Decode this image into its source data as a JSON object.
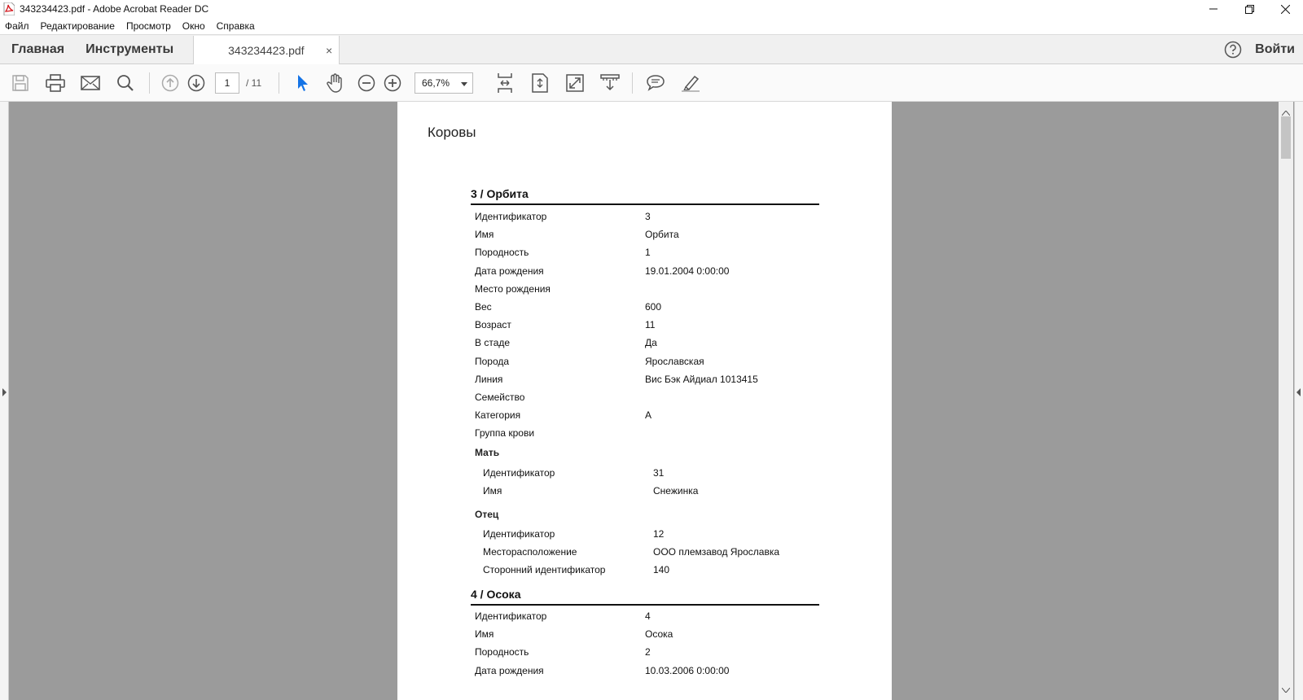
{
  "window": {
    "title": "343234423.pdf - Adobe Acrobat Reader DC"
  },
  "menu": [
    "Файл",
    "Редактирование",
    "Просмотр",
    "Окно",
    "Справка"
  ],
  "tabs": {
    "home": "Главная",
    "tools": "Инструменты",
    "document": "343234423.pdf",
    "close": "×",
    "login": "Войти"
  },
  "toolbar": {
    "page_current": "1",
    "page_total": "/  11",
    "zoom": "66,7%"
  },
  "document": {
    "title": "Коровы",
    "cow1": {
      "heading": "3 / Орбита",
      "fields": [
        {
          "k": "Идентификатор",
          "v": "3"
        },
        {
          "k": "Имя",
          "v": "Орбита"
        },
        {
          "k": "Породность",
          "v": "1"
        },
        {
          "k": "Дата рождения",
          "v": "19.01.2004 0:00:00"
        },
        {
          "k": "Место рождения",
          "v": ""
        },
        {
          "k": "Вес",
          "v": "600"
        },
        {
          "k": "Возраст",
          "v": "11"
        },
        {
          "k": "В стаде",
          "v": "Да"
        },
        {
          "k": "Порода",
          "v": "Ярославская"
        },
        {
          "k": "Линия",
          "v": "Вис Бэк Айдиал 1013415"
        },
        {
          "k": "Семейство",
          "v": ""
        },
        {
          "k": "Категория",
          "v": "А"
        },
        {
          "k": "Группа крови",
          "v": ""
        }
      ],
      "mother": {
        "label": "Мать",
        "fields": [
          {
            "k": "Идентификатор",
            "v": "31"
          },
          {
            "k": "Имя",
            "v": "Снежинка"
          }
        ]
      },
      "father": {
        "label": "Отец",
        "fields": [
          {
            "k": "Идентификатор",
            "v": "12"
          },
          {
            "k": "Месторасположение",
            "v": "ООО племзавод Ярославка"
          },
          {
            "k": "Сторонний идентификатор",
            "v": "140"
          }
        ]
      }
    },
    "cow2": {
      "heading": "4 / Осока",
      "fields": [
        {
          "k": "Идентификатор",
          "v": "4"
        },
        {
          "k": "Имя",
          "v": "Осока"
        },
        {
          "k": "Породность",
          "v": "2"
        },
        {
          "k": "Дата рождения",
          "v": "10.03.2006 0:00:00"
        }
      ]
    }
  }
}
